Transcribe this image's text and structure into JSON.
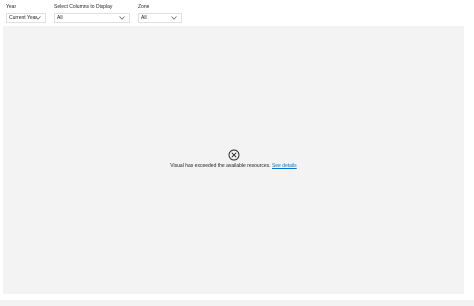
{
  "filters": [
    {
      "label": "Year",
      "value": "Current Year"
    },
    {
      "label": "Select Columns to Display",
      "value": "All"
    },
    {
      "label": "Zone",
      "value": "All"
    }
  ],
  "visual": {
    "icon": "circle-x-icon",
    "message": "Visual has exceeded the available resources.",
    "link_label": "See details"
  },
  "colors": {
    "canvas": "#f3f3f3",
    "link": "#0078d4",
    "text": "#252423",
    "border": "#e1dfdd"
  }
}
